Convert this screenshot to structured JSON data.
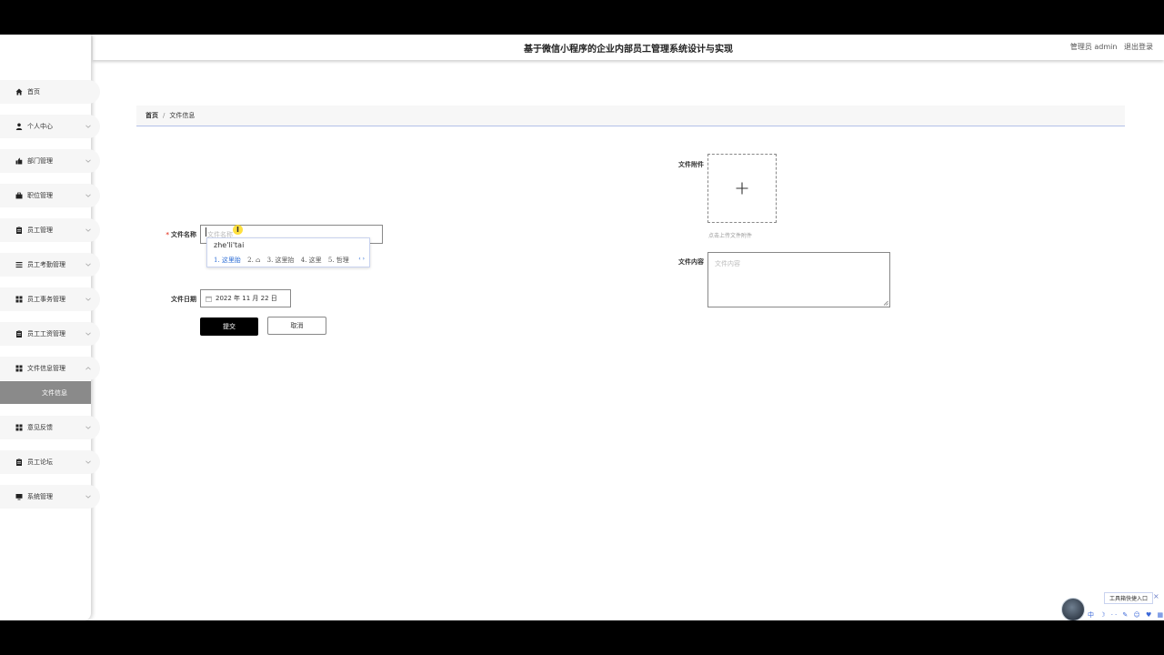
{
  "header": {
    "title": "基于微信小程序的企业内部员工管理系统设计与实现",
    "user": "管理员 admin",
    "logout": "退出登录"
  },
  "sidebar": {
    "items": [
      {
        "label": "首页",
        "icon": "home-icon"
      },
      {
        "label": "个人中心",
        "icon": "user-icon"
      },
      {
        "label": "部门管理",
        "icon": "thumb-icon"
      },
      {
        "label": "职位管理",
        "icon": "briefcase-icon"
      },
      {
        "label": "员工管理",
        "icon": "clipboard-icon"
      },
      {
        "label": "员工考勤管理",
        "icon": "list-icon"
      },
      {
        "label": "员工事务管理",
        "icon": "grid-icon"
      },
      {
        "label": "员工工资管理",
        "icon": "clipboard-icon"
      },
      {
        "label": "文件信息管理",
        "icon": "grid-icon"
      },
      {
        "label": "意见反馈",
        "icon": "grid-icon"
      },
      {
        "label": "员工论坛",
        "icon": "clipboard-icon"
      },
      {
        "label": "系统管理",
        "icon": "monitor-icon"
      }
    ],
    "subitem": "文件信息"
  },
  "breadcrumb": {
    "home": "首页",
    "separator": "/",
    "current": "文件信息"
  },
  "form": {
    "name_label": "文件名称",
    "name_placeholder": "文件名称",
    "date_label": "文件日期",
    "date_value": "2022 年 11 月 22 日",
    "attachment_label": "文件附件",
    "upload_tip": "点击上传文件附件",
    "content_label": "文件内容",
    "content_placeholder": "文件内容",
    "submit": "提交",
    "cancel": "取消"
  },
  "ime": {
    "composition": "zhe'li'tai",
    "candidates": [
      "1. 这里胎",
      "2. ⌂",
      "3. 这里抬",
      "4. 这里",
      "5. 哲理"
    ],
    "nav": "‹ ›"
  },
  "widgets": {
    "tool_entry": "工具箱快捷入口",
    "close": "×",
    "ime_bar": "中 ☽ ·· ✎ ☺ ♥ ▦ ♙"
  },
  "colors": {
    "accent": "#000000",
    "active_menu": "#8a8a8a",
    "required": "#e74c3c",
    "ime_blue": "#2f6fd6"
  }
}
